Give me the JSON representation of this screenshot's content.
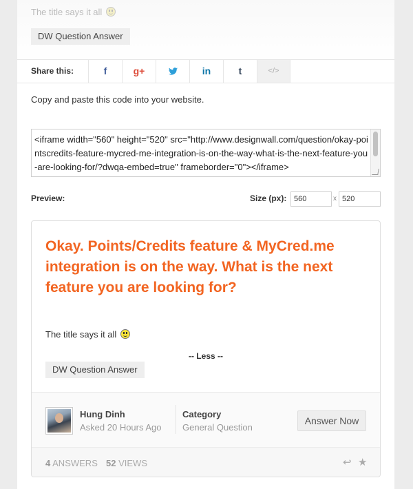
{
  "top": {
    "text": "The title says it all",
    "tag": "DW Question Answer"
  },
  "share": {
    "label": "Share this:",
    "buttons": [
      {
        "name": "facebook",
        "glyph": "f",
        "color": "#3b5998"
      },
      {
        "name": "google-plus",
        "glyph": "g+",
        "color": "#dd4b39"
      },
      {
        "name": "twitter",
        "glyph": "🐦",
        "color": "#2d9fd9"
      },
      {
        "name": "linkedin",
        "glyph": "in",
        "color": "#0e76a8"
      },
      {
        "name": "tumblr",
        "glyph": "t",
        "color": "#35465c"
      },
      {
        "name": "embed-code",
        "glyph": "</>",
        "color": "#aaaaaa"
      }
    ]
  },
  "embed": {
    "instruction": "Copy and paste this code into your website.",
    "code": "<iframe width=\"560\" height=\"520\" src=\"http://www.designwall.com/question/okay-pointscredits-feature-mycred-me-integration-is-on-the-way-what-is-the-next-feature-you-are-looking-for/?dwqa-embed=true\" frameborder=\"0\"></iframe>",
    "preview_label": "Preview:",
    "size_label": "Size (px):",
    "width": "560",
    "height": "520",
    "times": "x"
  },
  "question": {
    "title": "Okay. Points/Credits feature & MyCred.me integration is on the way. What is the next feature you are looking for?",
    "body": "The title says it all",
    "less": "-- Less --",
    "tag": "DW Question Answer",
    "author": "Hung Dinh",
    "asked": "Asked 20 Hours Ago",
    "category_label": "Category",
    "category": "General Question",
    "answer_button": "Answer Now",
    "answers_count": "4",
    "answers_label": "ANSWERS",
    "views_count": "52",
    "views_label": "VIEWS"
  },
  "colors": {
    "accent": "#f26522"
  }
}
